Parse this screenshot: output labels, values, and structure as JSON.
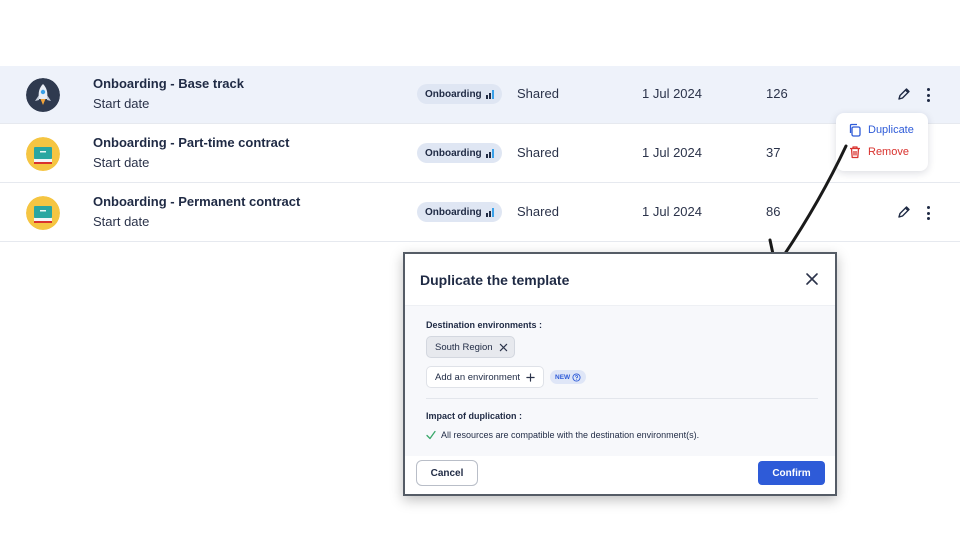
{
  "rows": [
    {
      "title": "Onboarding - Base track",
      "subtitle": "Start date",
      "tag": "Onboarding",
      "visibility": "Shared",
      "date": "1 Jul 2024",
      "count": "126",
      "icon": "rocket-icon"
    },
    {
      "title": "Onboarding - Part-time contract",
      "subtitle": "Start date",
      "tag": "Onboarding",
      "visibility": "Shared",
      "date": "1 Jul 2024",
      "count": "37",
      "icon": "book-icon"
    },
    {
      "title": "Onboarding - Permanent contract",
      "subtitle": "Start date",
      "tag": "Onboarding",
      "visibility": "Shared",
      "date": "1 Jul 2024",
      "count": "86",
      "icon": "book-icon"
    }
  ],
  "menu": {
    "duplicate": "Duplicate",
    "remove": "Remove"
  },
  "modal": {
    "title": "Duplicate the template",
    "destination_label": "Destination environments :",
    "selected_environment": "South Region",
    "add_environment": "Add an environment",
    "new_badge": "NEW",
    "impact_label": "Impact of duplication :",
    "compatibility_message": "All resources are compatible with the destination environment(s).",
    "cancel": "Cancel",
    "confirm": "Confirm"
  },
  "colors": {
    "accent": "#2e5bd8",
    "danger": "#d9322e",
    "success": "#3aa86b",
    "highlight_row": "#eef2fa"
  }
}
